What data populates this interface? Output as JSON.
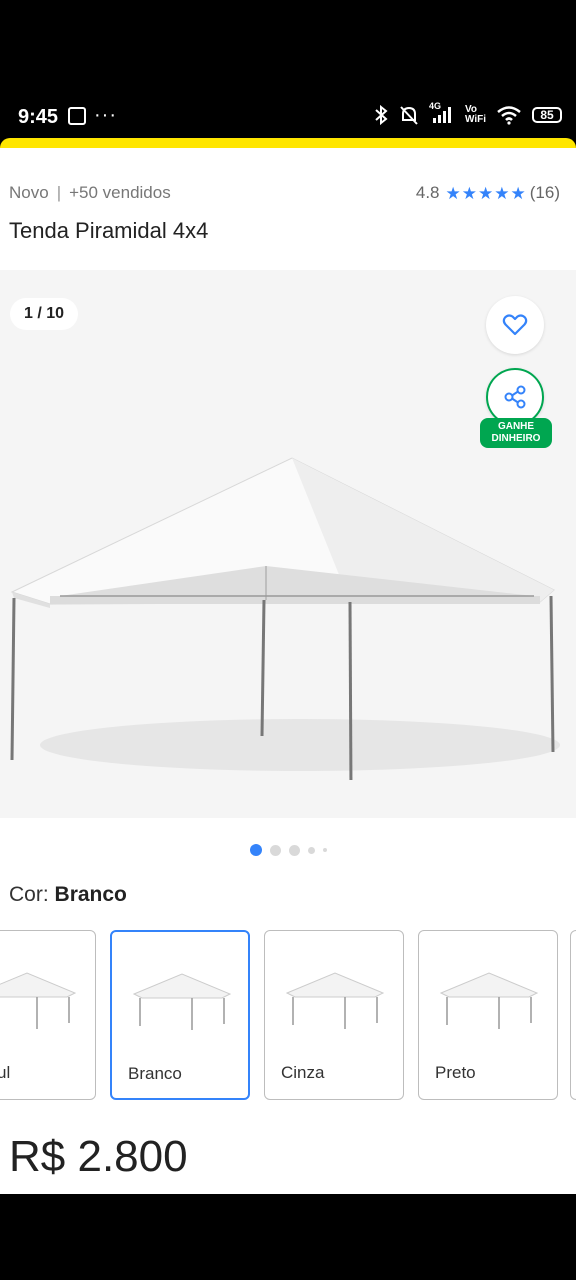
{
  "status_bar": {
    "time": "9:45",
    "more": "···",
    "network": "4G",
    "vowifi": "Vo\nWiFi",
    "battery": "85"
  },
  "product": {
    "condition": "Novo",
    "sold": "+50 vendidos",
    "rating_value": "4.8",
    "rating_count": "(16)",
    "title": "Tenda Piramidal 4x4",
    "price": "R$ 2.800"
  },
  "gallery": {
    "counter": "1 / 10",
    "earn_badge_line1": "GANHE",
    "earn_badge_line2": "DINHEIRO",
    "dots": 5,
    "active_dot": 0
  },
  "color": {
    "label": "Cor:",
    "selected": "Branco",
    "options": [
      "ul",
      "Branco",
      "Cinza",
      "Preto"
    ]
  },
  "colors": {
    "accent_blue": "#3483fa",
    "green": "#00a650",
    "yellow": "#ffe600"
  }
}
